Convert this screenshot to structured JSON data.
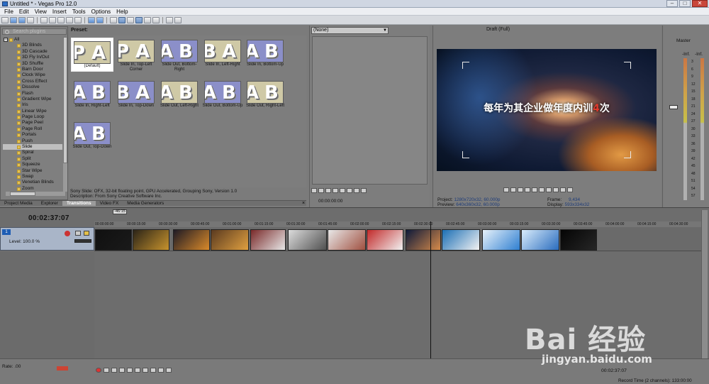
{
  "window": {
    "title": "Untitled * - Vegas Pro 12.0"
  },
  "menu": [
    "File",
    "Edit",
    "View",
    "Insert",
    "Tools",
    "Options",
    "Help"
  ],
  "explorer": {
    "search_placeholder": "Search plugins",
    "tree": [
      "All",
      "3D Blinds",
      "3D Cascade",
      "3D Fly In/Out",
      "3D Shuffle",
      "Barn Door",
      "Clock Wipe",
      "Cross Effect",
      "Dissolve",
      "Flash",
      "Gradient Wipe",
      "Iris",
      "Linear Wipe",
      "Page Loop",
      "Page Peel",
      "Page Roll",
      "Portals",
      "Push",
      "Slide",
      "Spiral",
      "Split",
      "Squeeze",
      "Star Wipe",
      "Swap",
      "Venetian Blinds",
      "Zoom"
    ],
    "selected": "Slide"
  },
  "tabs": [
    "Project Media",
    "Explorer",
    "Transitions",
    "Video FX",
    "Media Generators"
  ],
  "active_tab": "Transitions",
  "preset": {
    "label": "Preset:",
    "items": [
      "(Default)",
      "Slide In, Top-Left Corner",
      "Slide Out, Bottom-Right",
      "Slide In, Left-Right",
      "Slide In, Bottom-Up",
      "Slide In, Right-Left",
      "Slide In, Top-Down",
      "Slide Out, Left-Right",
      "Slide Out, Bottom-Up",
      "Slide Out, Right-Left",
      "Slide Out, Top-Down"
    ],
    "selected": "(Default)",
    "description_line1": "Sony Slide: OFX, 32-bit floating point, GPU Accelerated, Grouping Sony, Version 1.0",
    "description_line2": "Description: From Sony Creative Software Inc."
  },
  "middle": {
    "dropdown_value": "(None)",
    "time": "00:00:00:00"
  },
  "preview": {
    "quality": "Draft (Full)",
    "overlay_text_before": "每年为其企业做年度内训",
    "overlay_text_highlight": "4",
    "overlay_text_after": "次",
    "project_label": "Project:",
    "project_value": "1280x720x32, 60.000p",
    "preview_label": "Preview:",
    "preview_value": "640x360x32, 60.000p",
    "frame_label": "Frame:",
    "frame_value": "9,434",
    "display_label": "Display:",
    "display_value": "593x334x32"
  },
  "mixer": {
    "label": "Master",
    "scale": [
      "3",
      "6",
      "9",
      "12",
      "15",
      "18",
      "21",
      "24",
      "27",
      "30",
      "33",
      "36",
      "39",
      "42",
      "45",
      "48",
      "51",
      "54",
      "57"
    ],
    "peak_left": "-Inf.",
    "peak_right": "-Inf."
  },
  "timeline": {
    "timecode": "00:02:37:07",
    "marker": "-46:15",
    "ruler": [
      "00:00:00:00",
      "00:00:15:00",
      "00:00:30:00",
      "00:00:45:00",
      "00:01:00:00",
      "00:01:15:00",
      "00:01:30:00",
      "00:01:45:00",
      "00:02:00:00",
      "00:02:15:00",
      "00:02:30:00",
      "00:02:45:00",
      "00:03:00:00",
      "00:03:15:00",
      "00:03:30:00",
      "00:03:45:00",
      "00:04:00:00",
      "00:04:15:00",
      "00:04:30:00"
    ],
    "track_number": "1",
    "level": "Level: 100.0 %",
    "rate": "Rate: .00",
    "bottom_time": "00:02:37:07",
    "record_time": "Record Time (2 channels): 133:00:00"
  },
  "watermark": {
    "logo": "Bai 经验",
    "url": "jingyan.baidu.com"
  }
}
